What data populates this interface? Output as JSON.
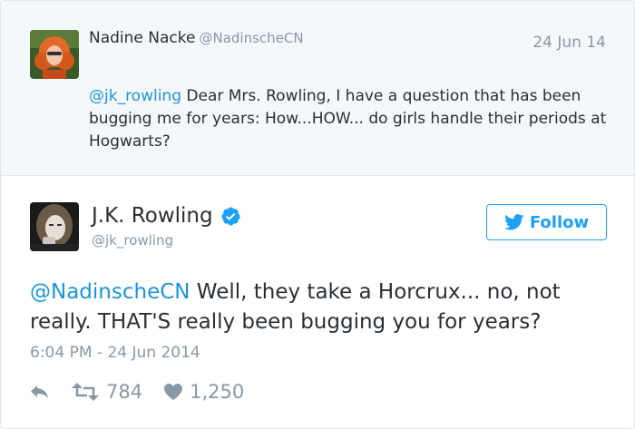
{
  "parent_tweet": {
    "author_name": "Nadine Nacke",
    "author_handle": "@NadinscheCN",
    "date": "24 Jun 14",
    "mention": "@jk_rowling",
    "text": " Dear Mrs. Rowling, I have a question that has been bugging me for years: How...HOW... do girls handle their periods at Hogwarts?"
  },
  "main_tweet": {
    "author_name": "J.K. Rowling",
    "author_handle": "@jk_rowling",
    "verified_icon": "verified-badge-icon",
    "follow_label": "Follow",
    "mention": "@NadinscheCN",
    "text": " Well, they take a Horcrux... no, not really. THAT'S really been bugging you for years?",
    "timestamp": "6:04 PM - 24 Jun 2014",
    "retweets": "784",
    "likes": "1,250"
  },
  "colors": {
    "accent": "#1da1f2",
    "link": "#1b95e0",
    "muted": "#8899a6",
    "parent_bg": "#f5f8fa"
  }
}
